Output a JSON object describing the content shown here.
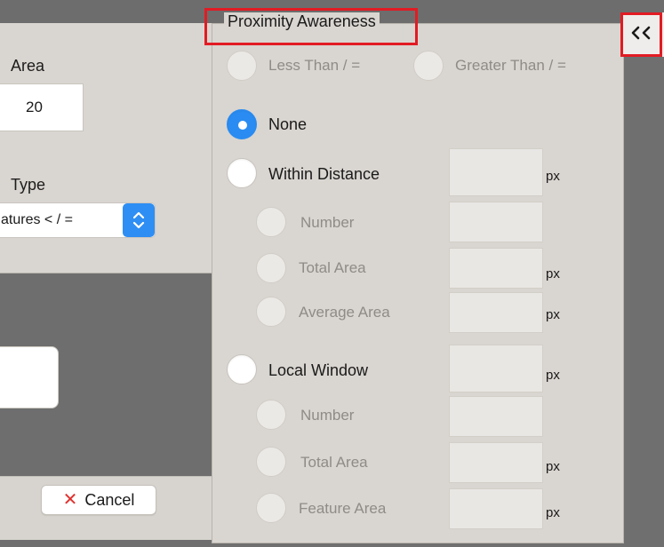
{
  "left_panel": {
    "area_label": "Area",
    "area_value": "20",
    "type_label": "Type",
    "type_select_value": "atures < / ="
  },
  "cancel_button": {
    "label": "Cancel",
    "icon": "close-icon"
  },
  "proximity": {
    "title": "Proximity Awareness",
    "collapse_label": "‹‹",
    "comparison": {
      "less_than": "Less Than / =",
      "greater_than": "Greater Than / ="
    },
    "none_label": "None",
    "within_distance": {
      "label": "Within Distance",
      "unit": "px",
      "options": [
        "Number",
        "Total Area",
        "Average Area"
      ],
      "units": [
        "",
        "px",
        "px"
      ]
    },
    "local_window": {
      "label": "Local Window",
      "unit": "px",
      "options": [
        "Number",
        "Total Area",
        "Feature Area"
      ],
      "units": [
        "",
        "px",
        "px"
      ]
    }
  },
  "colors": {
    "accent": "#2a8cf2",
    "highlight": "#e21b23",
    "panel": "#d9d5d0",
    "backdrop": "#6f6f6f"
  }
}
